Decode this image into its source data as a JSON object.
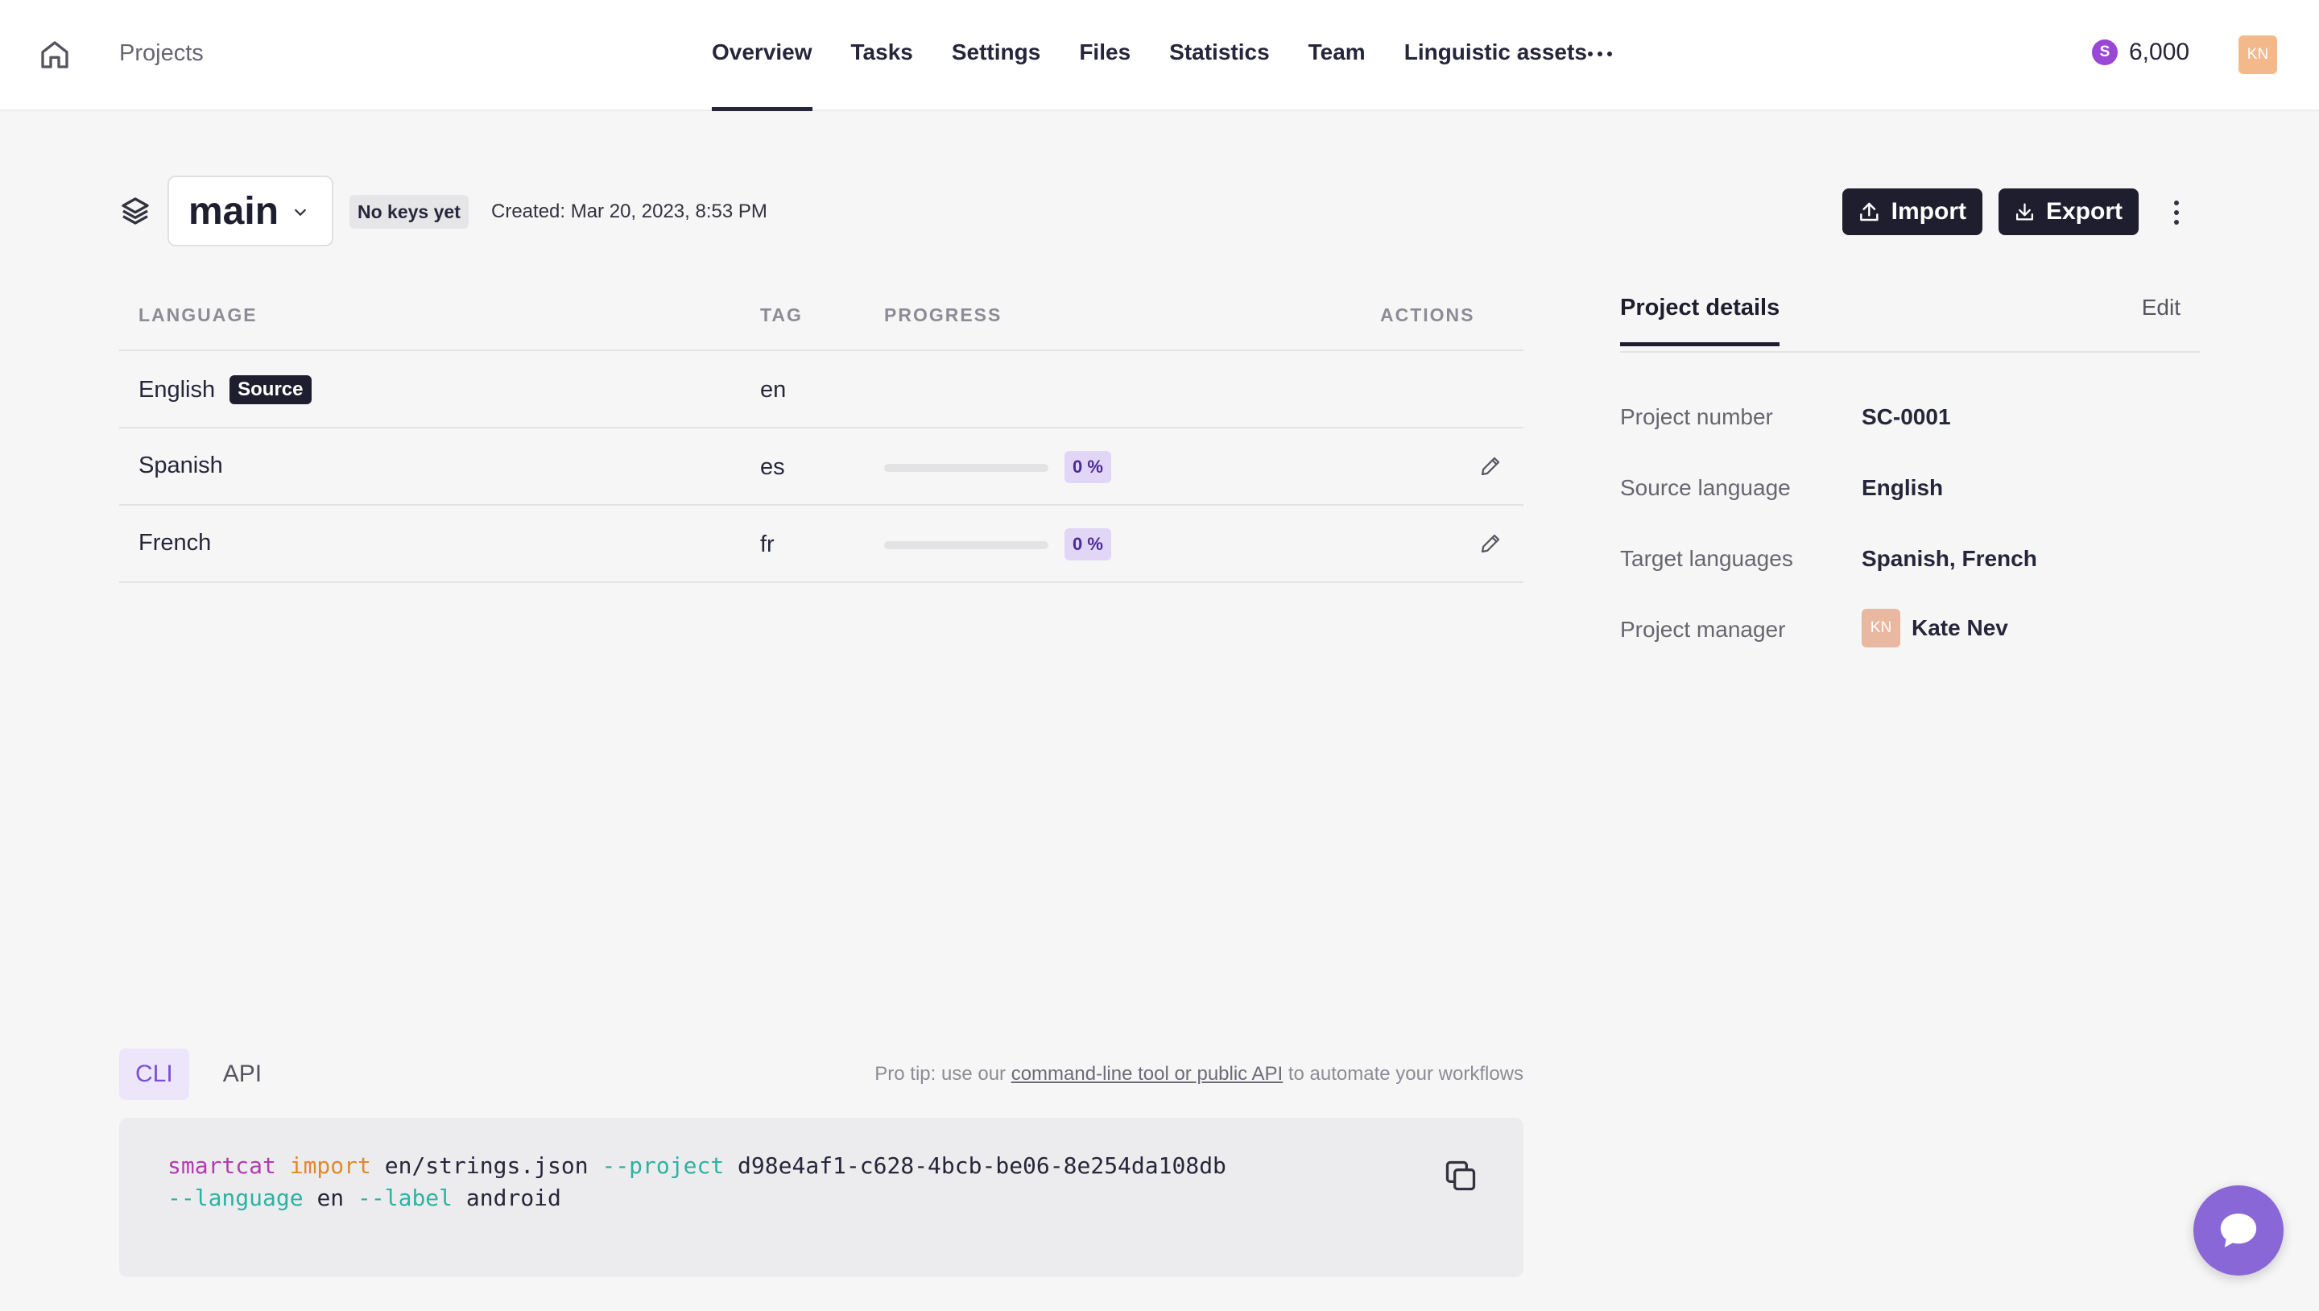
{
  "topbar": {
    "breadcrumb": "Projects",
    "tabs": [
      "Overview",
      "Tasks",
      "Settings",
      "Files",
      "Statistics",
      "Team",
      "Linguistic assets"
    ],
    "active_tab": "Overview",
    "credits_badge": "S",
    "credits": "6,000",
    "user_initials": "KN"
  },
  "header": {
    "branch": "main",
    "keys_badge": "No keys yet",
    "created": "Created: Mar 20, 2023, 8:53 PM",
    "import_label": "Import",
    "export_label": "Export"
  },
  "table": {
    "columns": [
      "LANGUAGE",
      "TAG",
      "PROGRESS",
      "ACTIONS"
    ],
    "rows": [
      {
        "language": "English",
        "badge": "Source",
        "tag": "en"
      },
      {
        "language": "Spanish",
        "tag": "es",
        "progress": 0,
        "progress_label": "0 %"
      },
      {
        "language": "French",
        "tag": "fr",
        "progress": 0,
        "progress_label": "0 %"
      }
    ]
  },
  "details": {
    "tab": "Project details",
    "edit_label": "Edit",
    "fields": [
      {
        "key": "Project number",
        "value": "SC-0001"
      },
      {
        "key": "Source language",
        "value": "English"
      },
      {
        "key": "Target languages",
        "value": "Spanish, French"
      },
      {
        "key": "Project manager",
        "value": "Kate Nev",
        "avatar": "KN"
      }
    ]
  },
  "code": {
    "tabs": [
      "CLI",
      "API"
    ],
    "active_tab": "CLI",
    "tip_prefix": "Pro tip: use our",
    "tip_link": "command-line tool or public API",
    "tip_suffix": "to automate your workflows",
    "line1": {
      "cmd": "smartcat",
      "sub": "import",
      "file": "en/strings.json",
      "flag_project": "--project",
      "project_id": "d98e4af1-c628-4bcb-be06-8e254da108db"
    },
    "line2": {
      "flag_language": "--language",
      "language": "en",
      "flag_label": "--label",
      "label": "android"
    }
  },
  "colors": {
    "dark": "#1e1e2e",
    "accent": "#7a4ed8",
    "credit": "#9b47d6",
    "chat": "#8a67d6"
  }
}
